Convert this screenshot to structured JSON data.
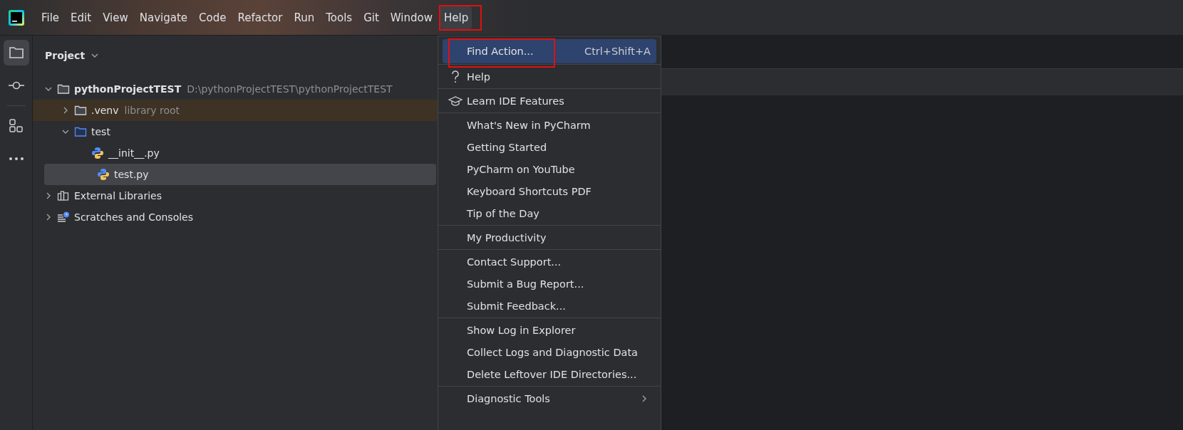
{
  "menu_bar": [
    {
      "label": "File",
      "selected": false,
      "annotated": false
    },
    {
      "label": "Edit",
      "selected": false,
      "annotated": false
    },
    {
      "label": "View",
      "selected": false,
      "annotated": false
    },
    {
      "label": "Navigate",
      "selected": false,
      "annotated": false
    },
    {
      "label": "Code",
      "selected": false,
      "annotated": false
    },
    {
      "label": "Refactor",
      "selected": false,
      "annotated": false
    },
    {
      "label": "Run",
      "selected": false,
      "annotated": false
    },
    {
      "label": "Tools",
      "selected": false,
      "annotated": false
    },
    {
      "label": "Git",
      "selected": false,
      "annotated": false
    },
    {
      "label": "Window",
      "selected": false,
      "annotated": false
    },
    {
      "label": "Help",
      "selected": true,
      "annotated": true
    }
  ],
  "toolbar": [
    {
      "kind": "folder",
      "selected": true
    },
    {
      "kind": "commit",
      "selected": false
    },
    {
      "kind": "structure",
      "selected": false
    },
    {
      "kind": "more",
      "selected": false
    }
  ],
  "project_panel": {
    "title": "Project",
    "tree": [
      {
        "label": "pythonProjectTEST",
        "hint": "D:\\pythonProjectTEST\\pythonProjectTEST",
        "kind": "folder",
        "expanded": true,
        "selected": false,
        "highlighted": false,
        "children": [
          {
            "label": ".venv",
            "hint": "library root",
            "kind": "folder",
            "expanded": false,
            "selected": false,
            "highlighted": true
          },
          {
            "label": "test",
            "kind": "source-folder",
            "expanded": true,
            "selected": false,
            "highlighted": false,
            "children": [
              {
                "label": "__init__.py",
                "kind": "python",
                "selected": false,
                "highlighted": false
              },
              {
                "label": "test.py",
                "kind": "python",
                "selected": true,
                "highlighted": false
              }
            ]
          }
        ]
      },
      {
        "label": "External Libraries",
        "kind": "libraries",
        "expanded": false,
        "selected": false,
        "highlighted": false
      },
      {
        "label": "Scratches and Consoles",
        "kind": "scratches",
        "expanded": false,
        "selected": false,
        "highlighted": false
      }
    ]
  },
  "help_menu": {
    "groups": [
      {
        "items": [
          {
            "label": "Find Action...",
            "shortcut": "Ctrl+Shift+A",
            "kind": "plain",
            "selected": true,
            "annotated": true
          }
        ]
      },
      {
        "items": [
          {
            "label": "Help",
            "kind": "question",
            "selected": false,
            "annotated": false
          }
        ]
      },
      {
        "items": [
          {
            "label": "Learn IDE Features",
            "kind": "cap",
            "selected": false,
            "annotated": false
          }
        ]
      },
      {
        "items": [
          {
            "label": "What's New in PyCharm",
            "kind": "plain",
            "selected": false,
            "annotated": false
          },
          {
            "label": "Getting Started",
            "kind": "plain",
            "selected": false,
            "annotated": false
          },
          {
            "label": "PyCharm on YouTube",
            "kind": "plain",
            "selected": false,
            "annotated": false
          },
          {
            "label": "Keyboard Shortcuts PDF",
            "kind": "plain",
            "selected": false,
            "annotated": false
          },
          {
            "label": "Tip of the Day",
            "kind": "plain",
            "selected": false,
            "annotated": false
          }
        ]
      },
      {
        "items": [
          {
            "label": "My Productivity",
            "kind": "plain",
            "selected": false,
            "annotated": false
          }
        ]
      },
      {
        "items": [
          {
            "label": "Contact Support...",
            "kind": "plain",
            "selected": false,
            "annotated": false
          },
          {
            "label": "Submit a Bug Report...",
            "kind": "plain",
            "selected": false,
            "annotated": false
          },
          {
            "label": "Submit Feedback...",
            "kind": "plain",
            "selected": false,
            "annotated": false
          }
        ]
      },
      {
        "items": [
          {
            "label": "Show Log in Explorer",
            "kind": "plain",
            "selected": false,
            "annotated": false
          },
          {
            "label": "Collect Logs and Diagnostic Data",
            "kind": "plain",
            "selected": false,
            "annotated": false
          },
          {
            "label": "Delete Leftover IDE Directories...",
            "kind": "plain",
            "selected": false,
            "annotated": false
          }
        ]
      },
      {
        "items": [
          {
            "label": "Diagnostic Tools",
            "kind": "submenu",
            "selected": false,
            "annotated": false
          }
        ]
      }
    ]
  }
}
